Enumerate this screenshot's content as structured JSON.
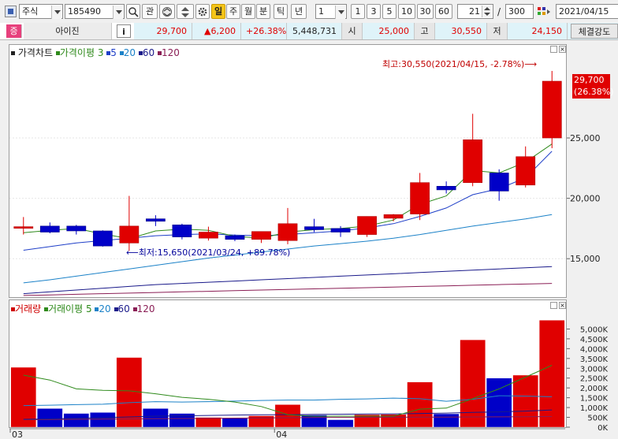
{
  "toolbar": {
    "market_select": "주식",
    "stock_code": "185490",
    "btn_gwan": "관",
    "period_buttons": [
      "일",
      "주",
      "월",
      "분",
      "틱",
      "년"
    ],
    "interval_select": "1",
    "interval_buttons": [
      "1",
      "3",
      "5",
      "10",
      "30",
      "60"
    ],
    "count_value": "21",
    "slash": "/",
    "count_total": "300",
    "date_value": "2021/04/15"
  },
  "quote": {
    "tag": "증",
    "name": "아이진",
    "info_btn": "i",
    "price": "29,700",
    "change": "▲6,200",
    "change_rate": "+26.38%",
    "volume": "5,448,731",
    "open_label": "시",
    "open": "25,000",
    "high_label": "고",
    "high": "30,550",
    "low_label": "저",
    "low": "24,150",
    "strength_btn": "체결강도"
  },
  "price_panel": {
    "legend": [
      {
        "text": "가격차트",
        "color": "#222222"
      },
      {
        "text": "가격이평",
        "color": "#2f8a1c"
      },
      {
        "text": "3",
        "color": "#2f8a1c"
      },
      {
        "text": "5",
        "color": "#1f3fc8"
      },
      {
        "text": "20",
        "color": "#1c82c8"
      },
      {
        "text": "60",
        "color": "#1a1a8a"
      },
      {
        "text": "120",
        "color": "#8a1e55"
      }
    ],
    "high_annotation": "최고:30,550(2021/04/15, -2.78%)⟶",
    "low_annotation": "⟵최저:15,650(2021/03/24, +89.78%)",
    "y_ticks": [
      "25,000",
      "20,000",
      "15,000"
    ],
    "current_price_tag": "29,700",
    "current_rate_tag": "(26.38%)"
  },
  "volume_panel": {
    "legend": [
      {
        "text": "거래량",
        "color": "#d00000"
      },
      {
        "text": "거래이평",
        "color": "#2f8a1c"
      },
      {
        "text": "5",
        "color": "#2f8a1c"
      },
      {
        "text": "20",
        "color": "#1c82c8"
      },
      {
        "text": "60",
        "color": "#1a1a8a"
      },
      {
        "text": "120",
        "color": "#8a1e55"
      }
    ],
    "y_ticks": [
      "5,000K",
      "4,500K",
      "4,000K",
      "3,500K",
      "3,000K",
      "2,500K",
      "2,000K",
      "1,500K",
      "1,000K",
      "500K",
      "0K"
    ]
  },
  "x_axis": {
    "labels": [
      "03",
      "04"
    ]
  },
  "colors": {
    "up": "#e00000",
    "down": "#0000c8"
  },
  "chart_data": {
    "type": "candlestick",
    "candles": [
      {
        "o": 17650,
        "h": 18450,
        "l": 17000,
        "c": 17650
      },
      {
        "o": 17700,
        "h": 18000,
        "l": 17100,
        "c": 17200
      },
      {
        "o": 17700,
        "h": 17800,
        "l": 17000,
        "c": 17300
      },
      {
        "o": 17300,
        "h": 17350,
        "l": 16000,
        "c": 16050
      },
      {
        "o": 16300,
        "h": 20200,
        "l": 15650,
        "c": 17700
      },
      {
        "o": 18300,
        "h": 18600,
        "l": 17700,
        "c": 18100
      },
      {
        "o": 17800,
        "h": 17900,
        "l": 16600,
        "c": 16800
      },
      {
        "o": 16700,
        "h": 17650,
        "l": 16500,
        "c": 17200
      },
      {
        "o": 16900,
        "h": 17000,
        "l": 16450,
        "c": 16600
      },
      {
        "o": 16600,
        "h": 17200,
        "l": 16300,
        "c": 17250
      },
      {
        "o": 16500,
        "h": 19200,
        "l": 16200,
        "c": 17900
      },
      {
        "o": 17650,
        "h": 18300,
        "l": 17200,
        "c": 17400
      },
      {
        "o": 17500,
        "h": 17700,
        "l": 16800,
        "c": 17200
      },
      {
        "o": 17000,
        "h": 18500,
        "l": 16800,
        "c": 18500
      },
      {
        "o": 18350,
        "h": 18700,
        "l": 18100,
        "c": 18650
      },
      {
        "o": 18700,
        "h": 22100,
        "l": 18200,
        "c": 21300
      },
      {
        "o": 21000,
        "h": 21400,
        "l": 20400,
        "c": 20700
      },
      {
        "o": 21300,
        "h": 27000,
        "l": 21000,
        "c": 24850
      },
      {
        "o": 22100,
        "h": 22400,
        "l": 19800,
        "c": 20600
      },
      {
        "o": 21100,
        "h": 24300,
        "l": 20900,
        "c": 23450
      },
      {
        "o": 25000,
        "h": 30550,
        "l": 24150,
        "c": 29700
      }
    ],
    "ma3": [
      17150,
      17350,
      17500,
      17050,
      16650,
      17300,
      17450,
      17350,
      16850,
      16700,
      17200,
      17400,
      17500,
      17700,
      18200,
      19500,
      20200,
      22300,
      22100,
      23000,
      24500
    ],
    "ma5": [
      15700,
      16000,
      16300,
      16500,
      16700,
      16900,
      17000,
      17050,
      16950,
      16900,
      17000,
      17150,
      17300,
      17550,
      17900,
      18500,
      19200,
      20300,
      20800,
      21700,
      23900
    ],
    "ma20": [
      13000,
      13250,
      13550,
      13850,
      14150,
      14450,
      14750,
      15050,
      15300,
      15550,
      15800,
      16050,
      16250,
      16450,
      16700,
      17000,
      17350,
      17700,
      18000,
      18300,
      18650
    ],
    "ma60": [
      12100,
      12250,
      12400,
      12550,
      12700,
      12850,
      12950,
      13050,
      13150,
      13250,
      13350,
      13450,
      13550,
      13650,
      13750,
      13850,
      13950,
      14050,
      14150,
      14250,
      14350
    ],
    "ma120": [
      11950,
      12000,
      12050,
      12100,
      12150,
      12200,
      12250,
      12300,
      12350,
      12400,
      12450,
      12500,
      12550,
      12600,
      12650,
      12700,
      12750,
      12800,
      12850,
      12900,
      12950
    ],
    "price_range": [
      11750,
      30550
    ],
    "volume": [
      3050,
      950,
      700,
      750,
      3550,
      950,
      700,
      500,
      450,
      580,
      1150,
      620,
      380,
      640,
      650,
      2300,
      680,
      4450,
      2500,
      2650,
      5450
    ],
    "vma5": [
      2650,
      2400,
      1950,
      1880,
      1850,
      1700,
      1520,
      1420,
      1280,
      1050,
      640,
      550,
      560,
      560,
      560,
      920,
      970,
      1450,
      1950,
      2550,
      3150
    ],
    "vma20": [
      1100,
      1120,
      1150,
      1170,
      1250,
      1300,
      1280,
      1300,
      1330,
      1360,
      1380,
      1380,
      1420,
      1440,
      1480,
      1450,
      1320,
      1420,
      1600,
      1580,
      1550
    ],
    "vma60": [
      400,
      420,
      450,
      480,
      520,
      560,
      580,
      600,
      620,
      630,
      640,
      650,
      660,
      670,
      680,
      700,
      720,
      750,
      780,
      820,
      880
    ],
    "vma120": [
      380,
      390,
      400,
      410,
      420,
      430,
      440,
      450,
      460,
      470,
      480,
      490,
      500,
      500,
      505,
      510,
      515,
      520,
      525,
      530,
      540
    ],
    "volume_range_k": [
      0,
      5700
    ],
    "up_flags": [
      true,
      false,
      false,
      false,
      true,
      false,
      false,
      true,
      false,
      true,
      true,
      false,
      false,
      true,
      true,
      true,
      false,
      true,
      false,
      true,
      true
    ]
  }
}
